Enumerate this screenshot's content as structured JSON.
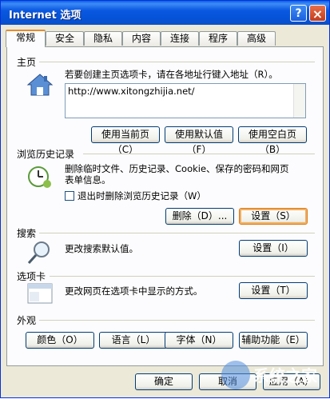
{
  "window": {
    "title": "Internet 选项",
    "help": "?",
    "close": "×"
  },
  "tabs": [
    "常规",
    "安全",
    "隐私",
    "内容",
    "连接",
    "程序",
    "高级"
  ],
  "home": {
    "section": "主页",
    "desc": "若要创建主页选项卡，请在各地址行键入地址（R）。",
    "url": "http://www.xitongzhijia.net/",
    "buttons": [
      "使用当前页（C）",
      "使用默认值（F）",
      "使用空白页（B）"
    ]
  },
  "history": {
    "section": "浏览历史记录",
    "desc_line1": "删除临时文件、历史记录、Cookie、保存的密码和网页",
    "desc_line2": "表单信息。",
    "checkbox": "退出时删除浏览历史记录（W）",
    "delete": "删除（D）...",
    "settings": "设置（S）"
  },
  "search": {
    "section": "搜索",
    "desc": "更改搜索默认值。",
    "settings": "设置（I）"
  },
  "tabsec": {
    "section": "选项卡",
    "desc": "更改网页在选项卡中显示的方式。",
    "settings": "设置（T）"
  },
  "appearance": {
    "section": "外观",
    "buttons": [
      "颜色（O）",
      "语言（L）",
      "字体（N）",
      "辅助功能（E）"
    ]
  },
  "footer": {
    "ok": "确定",
    "cancel": "取消",
    "apply": "应用（A）"
  },
  "watermark": "系统之家"
}
